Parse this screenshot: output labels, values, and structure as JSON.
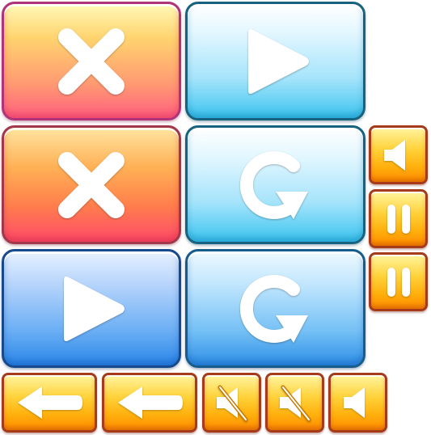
{
  "sheet": {
    "buttons": [
      {
        "id": "close-pink",
        "icon": "close-icon",
        "color": "#ff7f7a"
      },
      {
        "id": "play-cyan",
        "icon": "play-icon",
        "color": "#8fdcf8"
      },
      {
        "id": "close-coral",
        "icon": "close-icon",
        "color": "#ff8a52"
      },
      {
        "id": "replay-cyan",
        "icon": "replay-icon",
        "color": "#8fdcf8"
      },
      {
        "id": "play-blue",
        "icon": "play-icon",
        "color": "#5aa6f2"
      },
      {
        "id": "replay-blue",
        "icon": "replay-icon",
        "color": "#5ab0f2"
      },
      {
        "id": "sound-small",
        "icon": "speaker-icon",
        "color": "#ffc21a"
      },
      {
        "id": "pause-small-1",
        "icon": "pause-icon",
        "color": "#ffc21a"
      },
      {
        "id": "pause-small-2",
        "icon": "pause-icon",
        "color": "#ffc21a"
      },
      {
        "id": "back-1",
        "icon": "arrow-left-icon",
        "color": "#ffc21a"
      },
      {
        "id": "back-2",
        "icon": "arrow-left-icon",
        "color": "#ffc21a"
      },
      {
        "id": "mute-1",
        "icon": "speaker-muted-icon",
        "color": "#ffc21a"
      },
      {
        "id": "mute-2",
        "icon": "speaker-muted-icon",
        "color": "#ffc21a"
      },
      {
        "id": "sound-bottom",
        "icon": "speaker-icon",
        "color": "#ffc21a"
      }
    ]
  }
}
